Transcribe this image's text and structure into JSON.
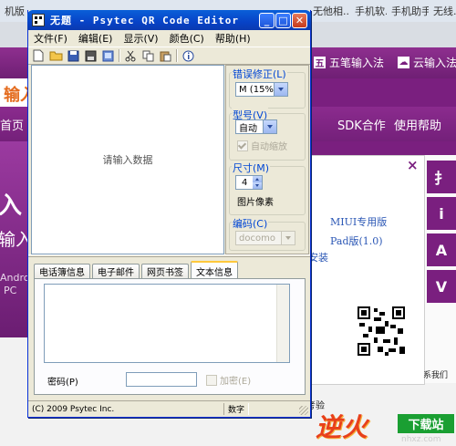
{
  "background": {
    "tabs": [
      {
        "label": "机版 - ...",
        "color": "#3b6fc4"
      },
      {
        "label": "无他相...",
        "color": "#2b8a3e"
      },
      {
        "label": "手机软...",
        "color": "#d1493b"
      },
      {
        "label": "手机助手...",
        "color": "#3b6fc4"
      },
      {
        "label": "无线...",
        "color": "#c33"
      }
    ],
    "header_links": [
      "五笔输入法",
      "云输入法"
    ],
    "header_link_icons": [
      "五",
      "☁"
    ],
    "logo_text": "输入",
    "nav_left": "首页",
    "nav_items": [
      "SDK合作",
      "使用帮助"
    ],
    "hero_big": "入",
    "hero_sub": "输入",
    "hero_small": [
      "Android",
      "PC"
    ],
    "popup": {
      "close": "×",
      "lines": [
        "MIUI专用版",
        "Pad版(1.0)",
        "安装"
      ]
    },
    "contact": "系我们",
    "footer_text": "考验",
    "watermark": {
      "fire": "逆火",
      "box": "下载站",
      "url": "nhxz.com"
    },
    "side_buttons": [
      "扌",
      "i",
      "A",
      "V"
    ]
  },
  "window": {
    "title": "无题 - Psytec QR Code Editor",
    "buttons": {
      "minimize": "_",
      "maximize": "□",
      "close": "✕"
    },
    "menu": [
      "文件(F)",
      "编辑(E)",
      "显示(V)",
      "颜色(C)",
      "帮助(H)"
    ],
    "toolbar_icons": [
      "new-file-icon",
      "open-folder-icon",
      "save-icon",
      "save-as-icon",
      "export-icon",
      "cut-icon",
      "copy-icon",
      "paste-icon",
      "info-icon"
    ],
    "input_placeholder": "请输入数据",
    "settings": {
      "error_correction_label": "错误修正(L)",
      "error_correction_value": "M (15%)",
      "model_label": "型号(V)",
      "model_value": "自动",
      "auto_zoom_label": "自动缩放",
      "size_label": "尺寸(M)",
      "size_value": "4",
      "size_unit": "图片像素",
      "encoding_label": "编码(C)",
      "encoding_value": "docomo"
    },
    "tabs": [
      "电话簿信息",
      "电子邮件",
      "网页书签",
      "文本信息"
    ],
    "active_tab": "文本信息",
    "password_label": "密码(P)",
    "encrypt_label": "加密(E)",
    "status_copyright": "(C) 2009 Psytec Inc.",
    "status_mode": "数字"
  }
}
